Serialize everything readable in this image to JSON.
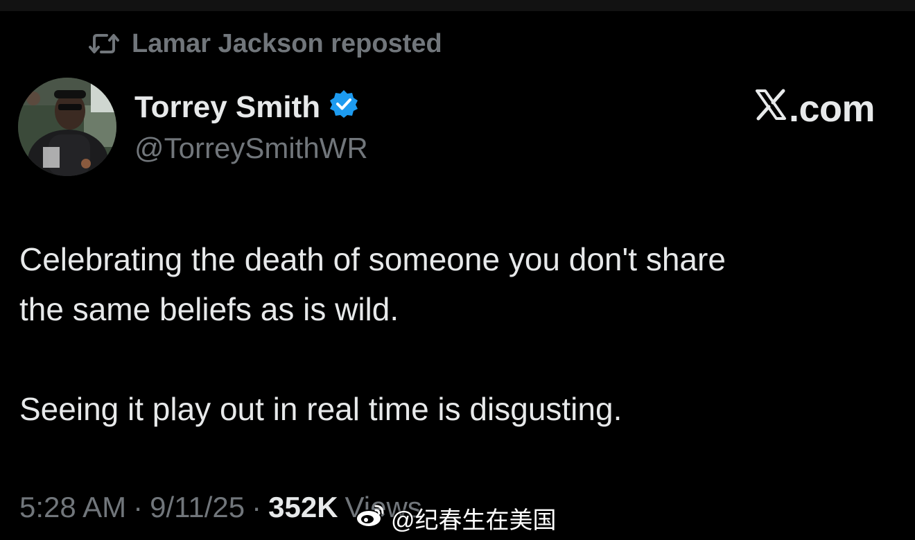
{
  "repost": {
    "icon": "repost-icon",
    "label": "Lamar Jackson reposted"
  },
  "author": {
    "avatar": "avatar",
    "name": "Torrey Smith",
    "verified_icon": "verified-badge-icon",
    "handle": "@TorreySmithWR"
  },
  "brand": {
    "icon": "x-logo-icon",
    "label": ".com"
  },
  "tweet": {
    "paragraph_1_line_1": "Celebrating the death of someone you don't share",
    "paragraph_1_line_2": "the same beliefs as is wild.",
    "paragraph_2": "Seeing it play out in real time is disgusting."
  },
  "meta": {
    "time": "5:28 AM",
    "separator": "·",
    "date": "9/11/25",
    "views_count": "352K",
    "views_label": "Views"
  },
  "watermark": {
    "icon": "weibo-icon",
    "text": "@纪春生在美国"
  },
  "colors": {
    "background": "#000000",
    "text_primary": "#e7e9ea",
    "text_secondary": "#71767b",
    "verified_blue": "#1d9bf0"
  }
}
